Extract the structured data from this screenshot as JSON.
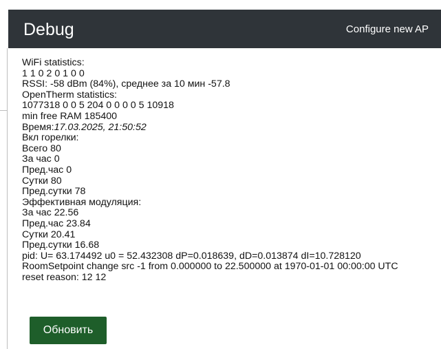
{
  "header": {
    "title": "Debug",
    "configure_link": "Configure new AP"
  },
  "stats": {
    "wifi_title": "WiFi statistics:",
    "wifi_values": "1 1 0 2 0 1 0 0",
    "rssi": "RSSI: -58 dBm (84%), среднее за 10 мин -57.8",
    "ot_title": "OpenTherm statistics:",
    "ot_values": "1077318 0 0 5 204 0 0 0 0 5 10918",
    "ram": "min free RAM 185400",
    "time_label": "Время:",
    "time_value": "17.03.2025, 21:50:52",
    "burner_title": "Вкл горелки:",
    "burner_total": "Всего 80",
    "burner_hour": "За час 0",
    "burner_prev_hour": "Пред.час 0",
    "burner_day": "Сутки 80",
    "burner_prev_day": "Пред.сутки 78",
    "mod_title": "Эффективная модуляция:",
    "mod_hour": "За час 22.56",
    "mod_prev_hour": "Пред.час 23.84",
    "mod_day": "Сутки 20.41",
    "mod_prev_day": "Пред.сутки 16.68",
    "pid": "pid: U= 63.174492 u0 = 52.432308 dP=0.018639, dD=0.013874 dI=10.728120",
    "room_setpoint": "RoomSetpoint change src -1 from 0.000000 to 22.500000 at 1970-01-01 00:00:00 UTC",
    "reset_reason": "reset reason: 12 12"
  },
  "buttons": {
    "refresh": "Обновить"
  },
  "colors": {
    "header_bg": "#2f3439",
    "button_bg": "#1e5e2a"
  }
}
